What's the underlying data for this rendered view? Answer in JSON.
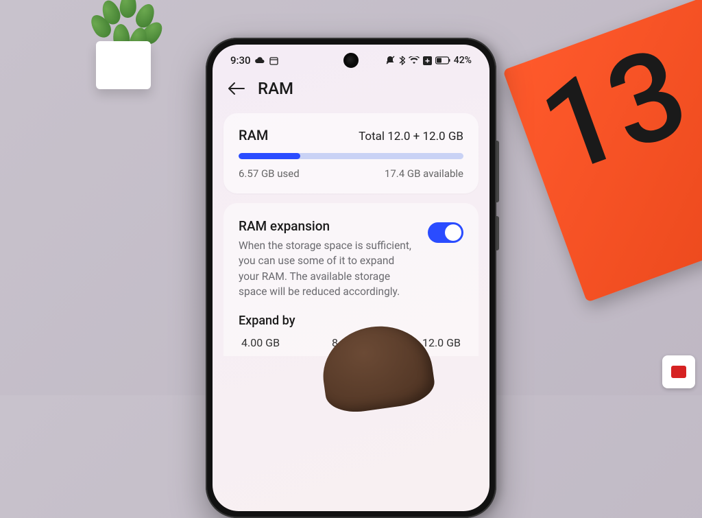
{
  "statusbar": {
    "time": "9:30",
    "battery_pct": "42%"
  },
  "header": {
    "title": "RAM"
  },
  "ram_card": {
    "label": "RAM",
    "total_text": "Total 12.0 + 12.0 GB",
    "used_text": "6.57 GB used",
    "available_text": "17.4 GB available",
    "used_gb": 6.57,
    "total_gb": 24.0
  },
  "expansion": {
    "title": "RAM expansion",
    "description": "When the storage space is sufficient, you can use some of it to expand your RAM. The available storage space will be reduced accordingly.",
    "enabled": true,
    "expand_by_label": "Expand by",
    "options": [
      "4.00 GB",
      "8.00 GB",
      "12.0 GB"
    ]
  },
  "box_label": "13",
  "colors": {
    "accent": "#2a4cff",
    "bar_track": "#c9d2f5"
  }
}
